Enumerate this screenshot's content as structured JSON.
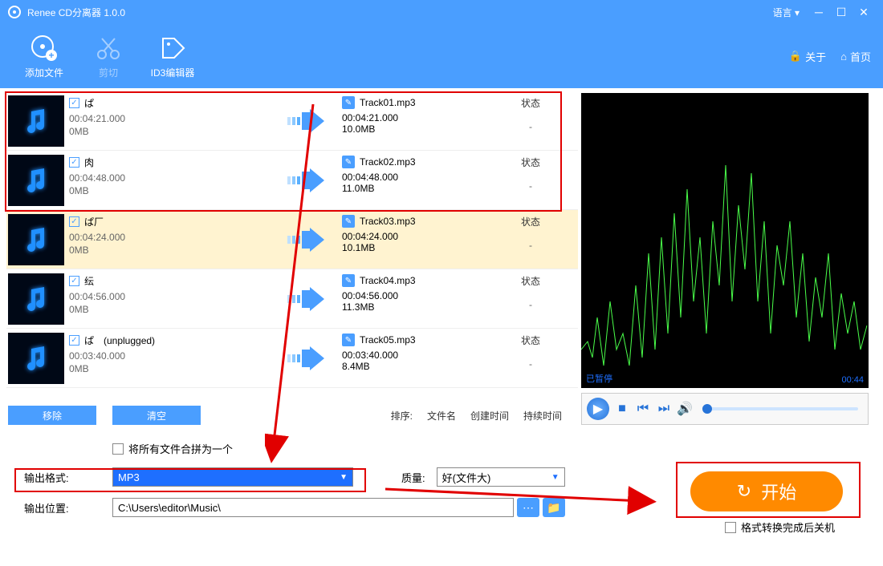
{
  "titlebar": {
    "title": "Renee CD分离器 1.0.0",
    "language": "语言"
  },
  "toolbar": {
    "add": "添加文件",
    "cut": "剪切",
    "id3": "ID3编辑器",
    "about": "关于",
    "home": "首页"
  },
  "tracks": [
    {
      "name": "ぱ",
      "dur": "00:04:21.000",
      "size": "0MB",
      "out": "Track01.mp3",
      "odur": "00:04:21.000",
      "osize": "10.0MB",
      "status": "状态",
      "dash": "-",
      "hl": false
    },
    {
      "name": "肉",
      "dur": "00:04:48.000",
      "size": "0MB",
      "out": "Track02.mp3",
      "odur": "00:04:48.000",
      "osize": "11.0MB",
      "status": "状态",
      "dash": "-",
      "hl": false
    },
    {
      "name": "ぱ厂",
      "dur": "00:04:24.000",
      "size": "0MB",
      "out": "Track03.mp3",
      "odur": "00:04:24.000",
      "osize": "10.1MB",
      "status": "状态",
      "dash": "-",
      "hl": true
    },
    {
      "name": "纭",
      "dur": "00:04:56.000",
      "size": "0MB",
      "out": "Track04.mp3",
      "odur": "00:04:56.000",
      "osize": "11.3MB",
      "status": "状态",
      "dash": "-",
      "hl": false
    },
    {
      "name": "ぱ　(unplugged)",
      "dur": "00:03:40.000",
      "size": "0MB",
      "out": "Track05.mp3",
      "odur": "00:03:40.000",
      "osize": "8.4MB",
      "status": "状态",
      "dash": "-",
      "hl": false
    }
  ],
  "actions": {
    "remove": "移除",
    "clear": "清空"
  },
  "sort": {
    "label": "排序:",
    "filename": "文件名",
    "created": "创建时间",
    "duration": "持续时间"
  },
  "preview": {
    "status": "已暂停",
    "time": "00:44"
  },
  "merge": {
    "label": "将所有文件合拼为一个"
  },
  "format": {
    "label": "输出格式:",
    "value": "MP3"
  },
  "quality": {
    "label": "质量:",
    "value": "好(文件大)"
  },
  "output": {
    "label": "输出位置:",
    "value": "C:\\Users\\editor\\Music\\"
  },
  "start": "开始",
  "shutdown": "格式转换完成后关机"
}
